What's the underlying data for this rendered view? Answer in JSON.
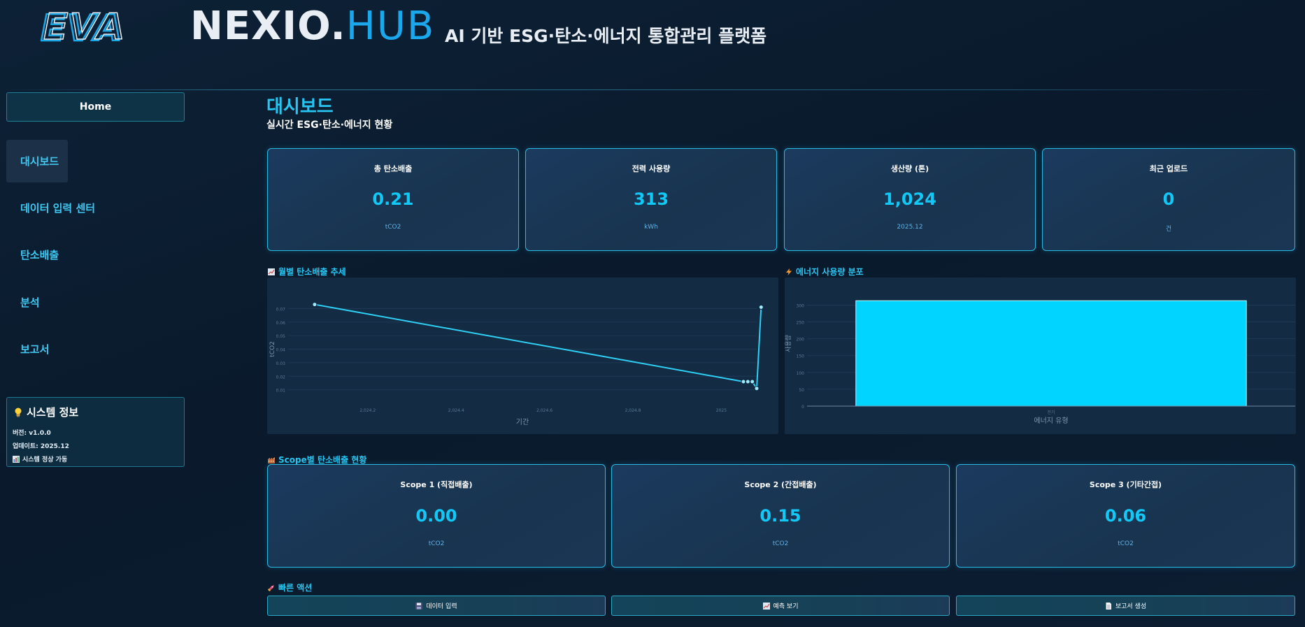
{
  "header": {
    "logo_eva": "EVA",
    "logo_nexio": "NEXIO.",
    "logo_hub": "HUB",
    "tagline": "AI 기반 ESG·탄소·에너지 통합관리 플랫폼"
  },
  "sidebar": {
    "home": "Home",
    "items": [
      {
        "label": "대시보드",
        "active": true
      },
      {
        "label": "데이터 입력 센터",
        "active": false
      },
      {
        "label": "탄소배출",
        "active": false
      },
      {
        "label": "분석",
        "active": false
      },
      {
        "label": "보고서",
        "active": false
      }
    ],
    "system_info": {
      "title": "시스템 정보",
      "version": "버전: v1.0.0",
      "updated": "업데이트: 2025.12",
      "status": "시스템 정상 가동"
    }
  },
  "main": {
    "title": "대시보드",
    "subtitle": "실시간 ESG·탄소·에너지 현황",
    "kpis": [
      {
        "label": "총 탄소배출",
        "value": "0.21",
        "unit": "tCO2"
      },
      {
        "label": "전력 사용량",
        "value": "313",
        "unit": "kWh"
      },
      {
        "label": "생산량 (톤)",
        "value": "1,024",
        "unit": "2025.12"
      },
      {
        "label": "최근 업로드",
        "value": "0",
        "unit": "건"
      }
    ],
    "trend_title": "월별 탄소배출 추세",
    "energy_title": "에너지 사용량 분포",
    "scope_title": "Scope별 탄소배출 현황",
    "scopes": [
      {
        "label": "Scope 1 (직접배출)",
        "value": "0.00",
        "unit": "tCO2"
      },
      {
        "label": "Scope 2 (간접배출)",
        "value": "0.15",
        "unit": "tCO2"
      },
      {
        "label": "Scope 3 (기타간접)",
        "value": "0.06",
        "unit": "tCO2"
      }
    ],
    "quick_title": "빠른 액션",
    "actions": [
      {
        "label": "데이터 입력"
      },
      {
        "label": "예측 보기"
      },
      {
        "label": "보고서 생성"
      }
    ]
  },
  "colors": {
    "accent": "#27c6f2",
    "bar": "#00d4ff",
    "line": "#2fd0f5"
  },
  "chart_data": [
    {
      "type": "line",
      "title": "월별 탄소배출 추세",
      "xlabel": "기간",
      "ylabel": "tCO2",
      "xlim": [
        2024.02,
        2025.08
      ],
      "ylim": [
        0,
        0.08
      ],
      "xticks": [
        2024.2,
        2024.4,
        2024.6,
        2024.8,
        2025
      ],
      "xtick_labels": [
        "2,024.2",
        "2,024.4",
        "2,024.6",
        "2,024.8",
        "2025"
      ],
      "yticks": [
        0.01,
        0.02,
        0.03,
        0.04,
        0.05,
        0.06,
        0.07
      ],
      "yticks_labels": [
        "0.01",
        "0.02",
        "0.03",
        "0.04",
        "0.05",
        "0.06",
        "0.07"
      ],
      "grid": true,
      "x": [
        2024.08,
        2025.05,
        2025.06,
        2025.07,
        2025.08,
        2025.09
      ],
      "y": [
        0.073,
        0.016,
        0.016,
        0.016,
        0.011,
        0.071
      ]
    },
    {
      "type": "bar",
      "title": "에너지 사용량 분포",
      "xlabel": "에너지 유형",
      "ylabel": "사용량",
      "categories": [
        "전기"
      ],
      "values": [
        313
      ],
      "ylim": [
        0,
        330
      ],
      "yticks": [
        0,
        50,
        100,
        150,
        200,
        250,
        300
      ]
    }
  ]
}
